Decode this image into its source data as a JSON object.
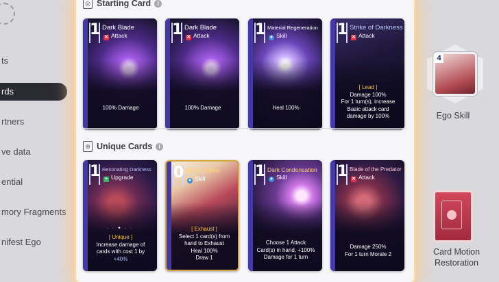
{
  "side_menu": {
    "items": [
      {
        "label": "ts",
        "active": false
      },
      {
        "label": "rds",
        "active": true
      },
      {
        "label": "rtners",
        "active": false
      },
      {
        "label": "ve data",
        "active": false
      },
      {
        "label": "ential",
        "active": false
      },
      {
        "label": "mory Fragments",
        "active": false
      },
      {
        "label": "nifest Ego",
        "active": false
      }
    ]
  },
  "popup": {
    "starting_title": "Starting Card",
    "unique_title": "Unique Cards",
    "info_glyph": "i"
  },
  "starting_cards": [
    {
      "cost": "1",
      "name": "Dark Blade",
      "type": "Attack",
      "type_icon": "attack-icon",
      "lines": [
        "",
        "",
        "100% Damage"
      ]
    },
    {
      "cost": "1",
      "name": "Dark Blade",
      "type": "Attack",
      "type_icon": "attack-icon",
      "lines": [
        "",
        "",
        "100% Damage"
      ]
    },
    {
      "cost": "1",
      "name": "Material Regeneration",
      "type": "Skill",
      "type_icon": "skill-icon",
      "lines": [
        "",
        "",
        "Heal 100%"
      ]
    },
    {
      "cost": "1",
      "name": "Strike of Darkness",
      "type": "Attack",
      "type_icon": "attack-icon",
      "lines": [
        "[ Lead ]",
        "Damage 100%",
        "For 1 turn(s), increase",
        "Basic attack card",
        "damage by 100%"
      ]
    }
  ],
  "unique_cards": [
    {
      "cost": "1",
      "name": "Resonating Darkness",
      "type": "Upgrade",
      "type_icon": "upgrade-icon",
      "lines": [
        "[ Unique ]",
        "Increase damage of",
        "cards with cost 1 by",
        "+40%"
      ]
    },
    {
      "cost": "0",
      "name": "Snack Time",
      "type": "Skill",
      "type_icon": "skill-icon",
      "lines": [
        "[ Exhaust ]",
        "Select 1 card(s) from",
        "hand to Exhaust",
        "Heal 100%",
        "Draw 1"
      ]
    },
    {
      "cost": "1",
      "name": "Dark Condensation",
      "type": "Skill",
      "type_icon": "skill-icon",
      "lines": [
        "Choose 1 Attack",
        "Card(s) in hand, +100%",
        "Damage for 1 turn"
      ]
    },
    {
      "cost": "1",
      "name": "Blade of the Predator",
      "type": "Attack",
      "type_icon": "attack-icon",
      "lines": [
        "Damage 250%",
        "For 1 turn Morale 2"
      ]
    }
  ],
  "right_panel": {
    "ego_cost": "4",
    "ego_label": "Ego Skill",
    "motion_label_1": "Card Motion",
    "motion_label_2": "Restoration"
  },
  "colors": {
    "card_bg": "#16122a",
    "stripe": "#4438a6",
    "highlight_blue": "#a9c3ff",
    "keyword_gold": "#f6c24c",
    "popup_glow": "#ffce8c"
  }
}
